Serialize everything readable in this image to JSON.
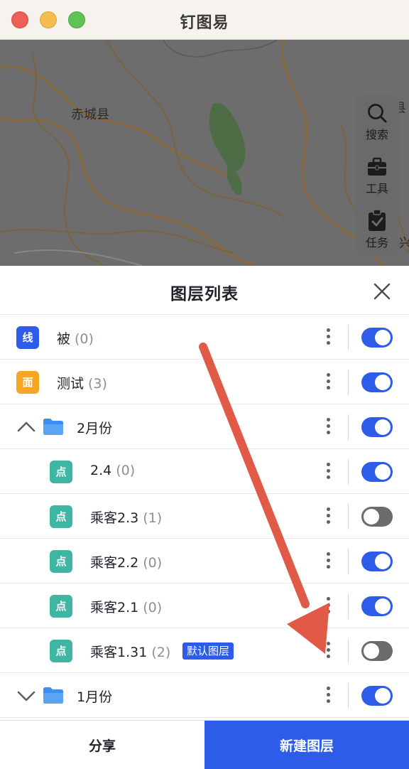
{
  "window": {
    "title": "钉图易"
  },
  "map": {
    "labels": {
      "county": "赤城县"
    },
    "tools": {
      "search": "搜索",
      "tools": "工具",
      "tasks": "任务"
    },
    "edge_glyphs": {
      "top_right": "县",
      "right": "兴"
    }
  },
  "panel": {
    "title": "图层列表",
    "rows": [
      {
        "type_label": "线",
        "name": "被",
        "count": "(0)",
        "visible": true
      },
      {
        "type_label": "面",
        "name": "测试",
        "count": "(3)",
        "visible": true
      },
      {
        "name": "2月份",
        "expanded": true,
        "visible": true
      },
      {
        "type_label": "点",
        "name": "2.4",
        "count": "(0)",
        "visible": true
      },
      {
        "type_label": "点",
        "name": "乘客2.3",
        "count": "(1)",
        "visible": false
      },
      {
        "type_label": "点",
        "name": "乘客2.2",
        "count": "(0)",
        "visible": true
      },
      {
        "type_label": "点",
        "name": "乘客2.1",
        "count": "(0)",
        "visible": true
      },
      {
        "type_label": "点",
        "name": "乘客1.31",
        "count": "(2)",
        "tag": "默认图层",
        "visible": false
      },
      {
        "name": "1月份",
        "expanded": false,
        "visible": true
      }
    ]
  },
  "footer": {
    "share": "分享",
    "new_layer": "新建图层"
  },
  "colors": {
    "accent": "#2d5ce8",
    "line_badge": "#2d5ce8",
    "area_badge": "#f5a623",
    "point_badge": "#3fb6a2",
    "annotation_arrow": "#e05a47"
  },
  "icons": [
    "close-icon",
    "search-icon",
    "toolbox-icon",
    "clipboard-check-icon",
    "chevron-up-icon",
    "chevron-down-icon",
    "folder-icon",
    "more-vertical-icon"
  ]
}
